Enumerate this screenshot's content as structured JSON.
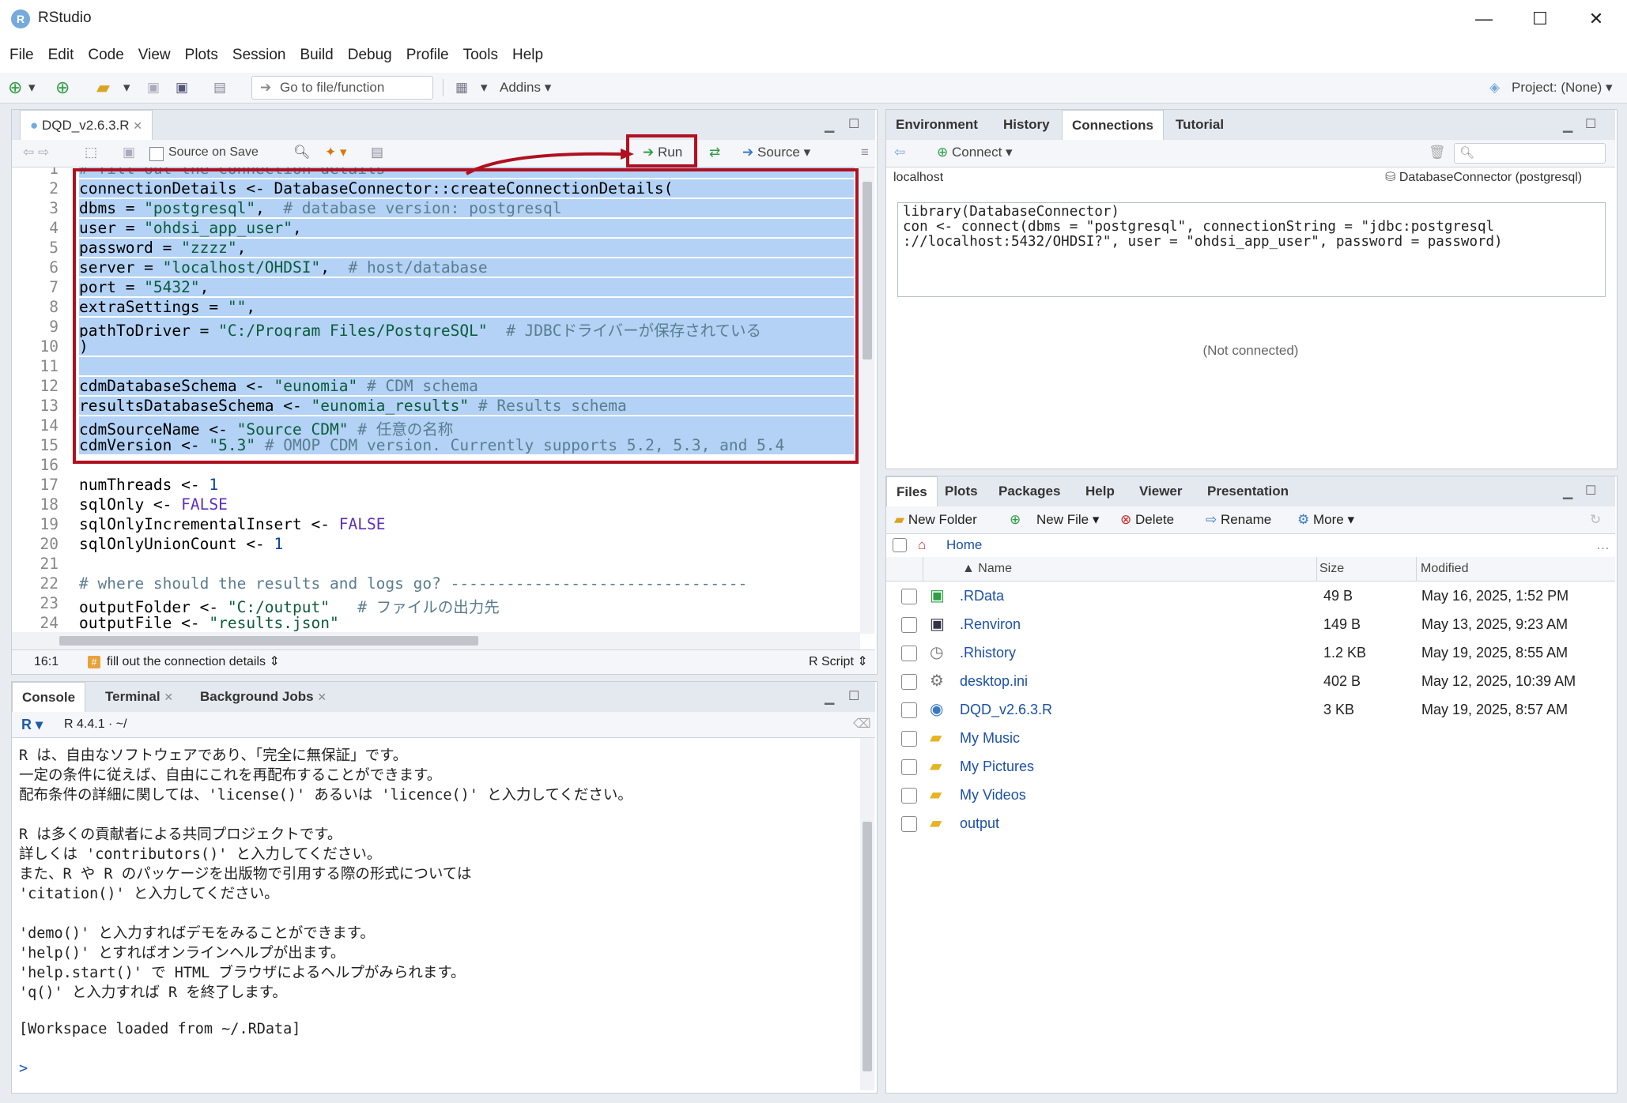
{
  "window": {
    "title": "RStudio",
    "minimize": "—",
    "maximize": "☐",
    "close": "✕"
  },
  "menu": [
    "File",
    "Edit",
    "Code",
    "View",
    "Plots",
    "Session",
    "Build",
    "Debug",
    "Profile",
    "Tools",
    "Help"
  ],
  "toolbar": {
    "goto_placeholder": "Go to file/function",
    "addins": "Addins",
    "project": "Project: (None)"
  },
  "editor": {
    "tab_label": "DQD_v2.6.3.R",
    "source_on_save": "Source on Save",
    "run_label": "Run",
    "source_label": "Source",
    "lines": [
      "# fill out the connection details ------------------------------------",
      "connectionDetails <- DatabaseConnector::createConnectionDetails(",
      "dbms = \"postgresql\",  # database version: postgresql",
      "user = \"ohdsi_app_user\",",
      "password = \"zzzz\",",
      "server = \"localhost/OHDSI\",  # host/database",
      "port = \"5432\",",
      "extraSettings = \"\",",
      "pathToDriver = \"C:/Program Files/PostgreSQL\"  # JDBCドライバーが保存されている",
      ")",
      "",
      "cdmDatabaseSchema <- \"eunomia\" # CDM schema",
      "resultsDatabaseSchema <- \"eunomia_results\" # Results schema",
      "cdmSourceName <- \"Source CDM\" # 任意の名称",
      "cdmVersion <- \"5.3\" # OMOP CDM version. Currently supports 5.2, 5.3, and 5.4",
      "",
      "numThreads <- 1",
      "sqlOnly <- FALSE",
      "sqlOnlyIncrementalInsert <- FALSE",
      "sqlOnlyUnionCount <- 1",
      "",
      "# where should the results and logs go? --------------------------------",
      "outputFolder <- \"C:/output\"   # ファイルの出力先",
      "outputFile <- \"results.json\""
    ],
    "status_pos": "16:1",
    "status_section": "fill out the connection details",
    "status_type": "R Script"
  },
  "console": {
    "tabs": [
      "Console",
      "Terminal",
      "Background Jobs"
    ],
    "version": "R 4.4.1 · ~/",
    "lines": [
      "R は、自由なソフトウェアであり、「完全に無保証」です。",
      "一定の条件に従えば、自由にこれを再配布することができます。",
      "配布条件の詳細に関しては、'license()' あるいは 'licence()' と入力してください。",
      "",
      "R は多くの貢献者による共同プロジェクトです。",
      "詳しくは 'contributors()' と入力してください。",
      "また、R や R のパッケージを出版物で引用する際の形式については",
      "'citation()' と入力してください。",
      "",
      "'demo()' と入力すればデモをみることができます。",
      "'help()' とすればオンラインヘルプが出ます。",
      "'help.start()' で HTML ブラウザによるヘルプがみられます。",
      "'q()' と入力すれば R を終了します。",
      "",
      "[Workspace loaded from ~/.RData]",
      "",
      ">"
    ]
  },
  "env_pane": {
    "tabs": [
      "Environment",
      "History",
      "Connections",
      "Tutorial"
    ],
    "connect": "Connect",
    "host": "localhost",
    "driver": "DatabaseConnector (postgresql)",
    "code_lines": [
      "library(DatabaseConnector)",
      "con <- connect(dbms = \"postgresql\", connectionString = \"jdbc:postgresql",
      "://localhost:5432/OHDSI?\", user = \"ohdsi_app_user\", password = password)"
    ],
    "status": "(Not connected)"
  },
  "files_pane": {
    "tabs": [
      "Files",
      "Plots",
      "Packages",
      "Help",
      "Viewer",
      "Presentation"
    ],
    "new_folder": "New Folder",
    "new_file": "New File",
    "delete": "Delete",
    "rename": "Rename",
    "more": "More",
    "home": "Home",
    "headers": {
      "name": "Name",
      "size": "Size",
      "modified": "Modified"
    },
    "rows": [
      {
        "name": ".RData",
        "size": "49 B",
        "modified": "May 16, 2025, 1:52 PM"
      },
      {
        "name": ".Renviron",
        "size": "149 B",
        "modified": "May 13, 2025, 9:23 AM"
      },
      {
        "name": ".Rhistory",
        "size": "1.2 KB",
        "modified": "May 19, 2025, 8:55 AM"
      },
      {
        "name": "desktop.ini",
        "size": "402 B",
        "modified": "May 12, 2025, 10:39 AM"
      },
      {
        "name": "DQD_v2.6.3.R",
        "size": "3 KB",
        "modified": "May 19, 2025, 8:57 AM"
      },
      {
        "name": "My Music",
        "size": "",
        "modified": ""
      },
      {
        "name": "My Pictures",
        "size": "",
        "modified": ""
      },
      {
        "name": "My Videos",
        "size": "",
        "modified": ""
      },
      {
        "name": "output",
        "size": "",
        "modified": ""
      }
    ]
  },
  "colors": {
    "highlight_red": "#b01020",
    "selection": "#b3d2f5",
    "link": "#1c50a8"
  }
}
